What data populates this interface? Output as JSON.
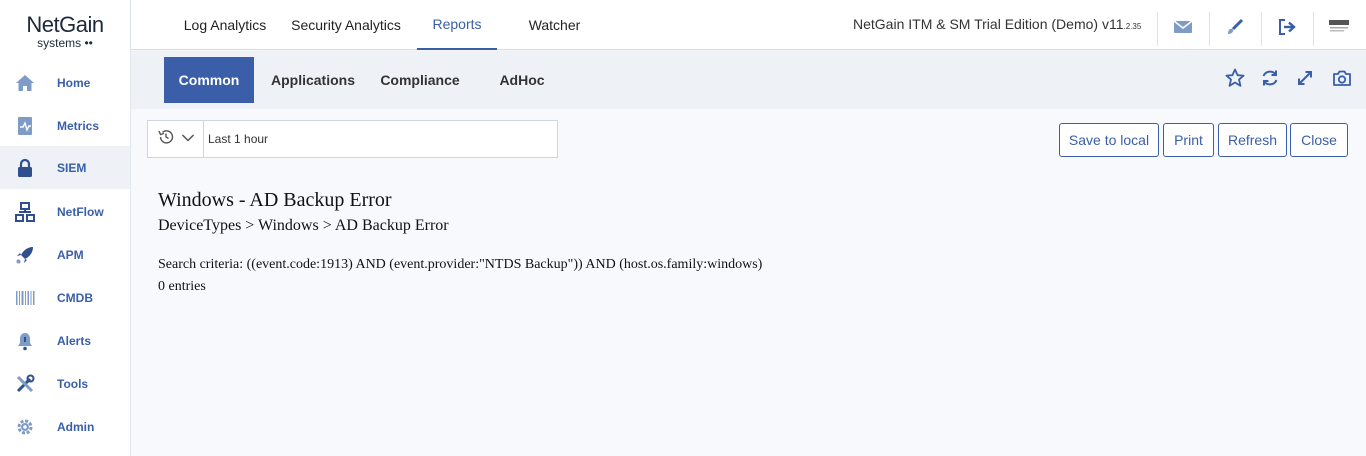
{
  "logo": {
    "main": "NetGain",
    "sub": "systems ••"
  },
  "sidebar": {
    "items": [
      {
        "label": "Home",
        "icon": "home-icon",
        "active": false
      },
      {
        "label": "Metrics",
        "icon": "metrics-icon",
        "active": false
      },
      {
        "label": "SIEM",
        "icon": "lock-icon",
        "active": true
      },
      {
        "label": "NetFlow",
        "icon": "network-icon",
        "active": false
      },
      {
        "label": "APM",
        "icon": "rocket-icon",
        "active": false
      },
      {
        "label": "CMDB",
        "icon": "barcode-icon",
        "active": false
      },
      {
        "label": "Alerts",
        "icon": "bell-icon",
        "active": false
      },
      {
        "label": "Tools",
        "icon": "tools-icon",
        "active": false
      },
      {
        "label": "Admin",
        "icon": "gear-icon",
        "active": false
      }
    ]
  },
  "topbar": {
    "tabs": [
      {
        "label": "Log Analytics",
        "active": false
      },
      {
        "label": "Security Analytics",
        "active": false
      },
      {
        "label": "Reports",
        "active": true
      },
      {
        "label": "Watcher",
        "active": false
      }
    ],
    "edition": "NetGain ITM & SM Trial Edition (Demo) v11",
    "version_suffix": ".2.35",
    "icons": [
      "mail-icon",
      "brush-icon",
      "logout-icon",
      "user-logo-icon"
    ]
  },
  "subbar": {
    "tabs": [
      {
        "label": "Common",
        "active": true
      },
      {
        "label": "Applications",
        "active": false
      },
      {
        "label": "Compliance",
        "active": false
      },
      {
        "label": "AdHoc",
        "active": false
      }
    ],
    "icons": [
      "star-icon",
      "refresh-icon",
      "expand-icon",
      "camera-icon"
    ]
  },
  "toolbar": {
    "time_range": "Last 1 hour",
    "save_label": "Save to local",
    "print_label": "Print",
    "refresh_label": "Refresh",
    "close_label": "Close"
  },
  "report": {
    "title": "Windows - AD Backup Error",
    "path": "DeviceTypes > Windows > AD Backup Error",
    "criteria": "Search criteria: ((event.code:1913) AND (event.provider:\"NTDS Backup\")) AND (host.os.family:windows)",
    "entries": "0 entries"
  },
  "colors": {
    "accent": "#3a5fa8",
    "subbar_bg": "#eef1f6",
    "content_bg": "#f8f9fc"
  }
}
